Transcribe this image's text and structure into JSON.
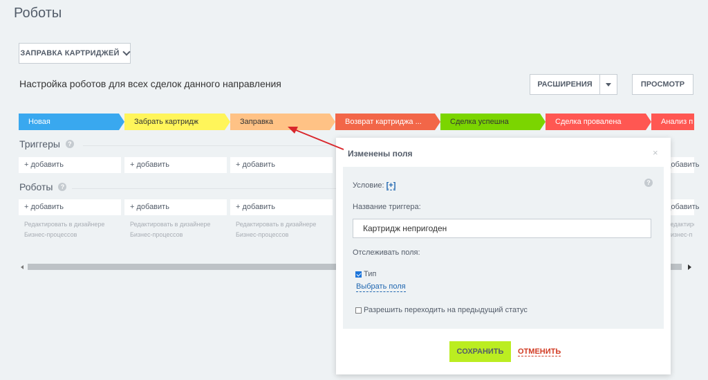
{
  "header": {
    "title": "Роботы",
    "direction_button": "ЗАПРАВКА КАРТРИДЖЕЙ",
    "subtitle": "Настройка роботов для всех сделок данного направления",
    "extensions_button": "РАСШИРЕНИЯ",
    "view_button": "ПРОСМОТР"
  },
  "stages": [
    {
      "label": "Новая",
      "color": "#39a8ef",
      "text_color": "#ffffff"
    },
    {
      "label": "Забрать картридж",
      "color": "#fff55a",
      "text_color": "#333333"
    },
    {
      "label": "Заправка",
      "color": "#ffc285",
      "text_color": "#333333"
    },
    {
      "label": "Возврат картриджа ...",
      "color": "#f26648",
      "text_color": "#ffffff"
    },
    {
      "label": "Сделка успешна",
      "color": "#7bd500",
      "text_color": "#333333"
    },
    {
      "label": "Сделка провалена",
      "color": "#ff5752",
      "text_color": "#ffffff"
    },
    {
      "label": "Анализ п",
      "color": "#ff5752",
      "text_color": "#ffffff"
    }
  ],
  "triggers": {
    "title": "Триггеры",
    "add_label": "+ добавить",
    "right_add_label": "добавить"
  },
  "robots": {
    "title": "Роботы",
    "add_label": "+ добавить",
    "right_add_label": "добавить",
    "hint_line1": "Редактировать в дизайнере",
    "hint_line2": "Бизнес-процессов",
    "right_hint_line1": "Редактиро",
    "right_hint_line2": "Бизнес-п"
  },
  "popup": {
    "title": "Изменены поля",
    "close": "×",
    "condition_label": "Условие:",
    "condition_link": "[+]",
    "trigger_name_label": "Название триггера:",
    "trigger_name_value": "Картридж непригоден",
    "track_fields_label": "Отслеживать поля:",
    "field_type_label": "Тип",
    "field_type_checked": true,
    "choose_fields_link": "Выбрать поля",
    "allow_prev_label": "Разрешить переходить на предыдущий статус",
    "allow_prev_checked": false,
    "save_button": "СОХРАНИТЬ",
    "cancel_link": "ОТМЕНИТЬ"
  },
  "colors": {
    "accent_save": "#bbed21",
    "cancel": "#d13a22",
    "link": "#2067b0",
    "arrow": "#d9262b"
  }
}
